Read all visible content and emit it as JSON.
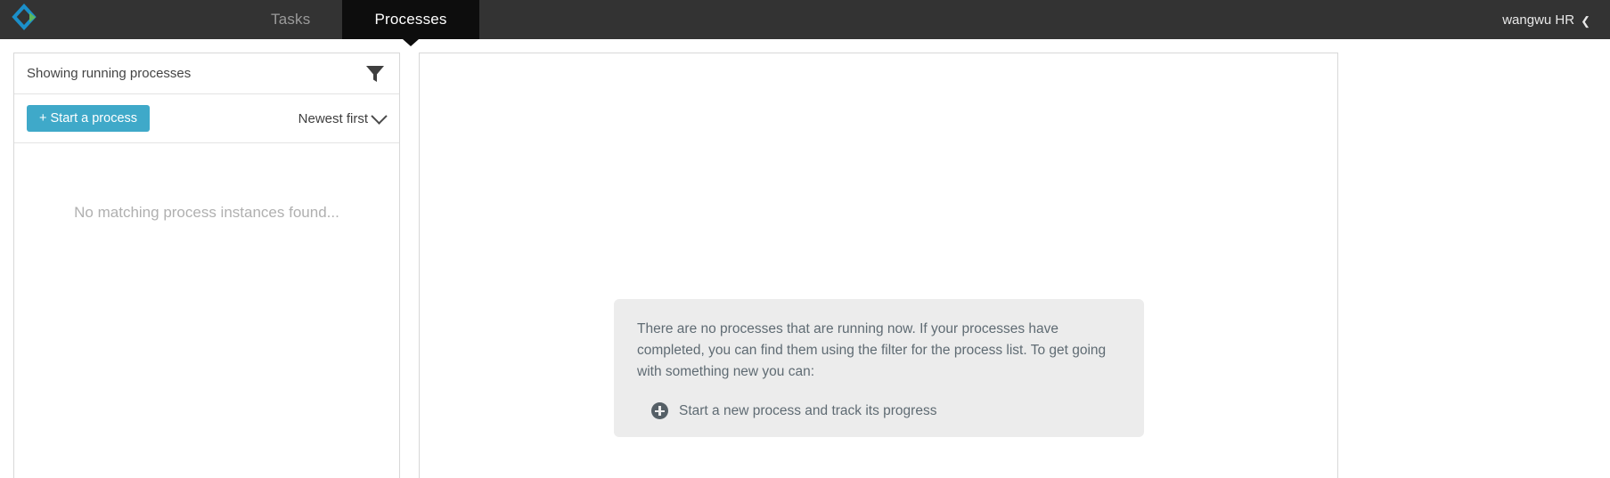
{
  "topbar": {
    "logo_icon": "diamond-logo-icon",
    "tabs": [
      {
        "label": "Tasks",
        "active": false
      },
      {
        "label": "Processes",
        "active": true
      }
    ],
    "user": {
      "label": "wangwu HR",
      "caret_icon": "chevron-down-icon"
    },
    "background_color": "#333333",
    "active_tab_color": "#0d0d0d"
  },
  "left_panel": {
    "header": {
      "title": "Showing running processes",
      "filter_icon": "funnel-filter-icon"
    },
    "start_button": {
      "label": "+ Start a process",
      "color": "#3fa9c9"
    },
    "sort": {
      "value": "Newest first",
      "caret_icon": "chevron-down-icon"
    },
    "empty_message": "No matching process instances found..."
  },
  "right_panel": {
    "message": {
      "paragraph": "There are no processes that are running now. If your processes have completed, you can find them using the filter for the process list. To get going with something new you can:",
      "items": [
        {
          "icon": "plus-circle-icon",
          "label": "Start a new process and track its progress"
        }
      ],
      "background_color": "#ececec"
    }
  }
}
